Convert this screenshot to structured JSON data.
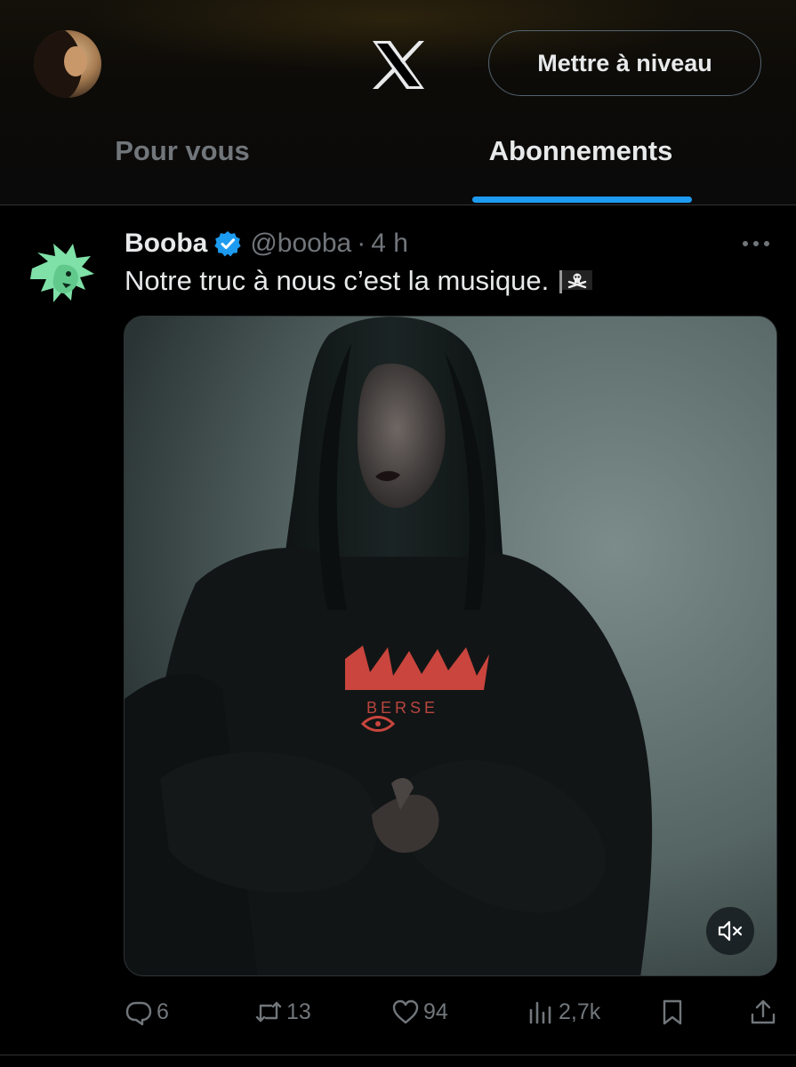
{
  "header": {
    "upgrade_label": "Mettre à niveau",
    "tabs": [
      {
        "label": "Pour vous",
        "active": false
      },
      {
        "label": "Abonnements",
        "active": true
      }
    ],
    "logo_icon": "x-logo-icon",
    "avatar_icon": "profile-avatar"
  },
  "tweet": {
    "author_name": "Booba",
    "verified": true,
    "handle": "@booba",
    "separator": "·",
    "time": "4 h",
    "text": "Notre truc à nous c’est la musique.",
    "emoji": "pirate-flag-icon",
    "media": {
      "type": "video",
      "shirt_text": "BERSE",
      "muted": true
    },
    "actions": {
      "replies": "6",
      "retweets": "13",
      "likes": "94",
      "views": "2,7k"
    }
  },
  "colors": {
    "background": "#000000",
    "accent": "#1d9bf0",
    "text_primary": "#e7e9ea",
    "text_secondary": "#71767b",
    "author_avatar_green": "#7fe0a8"
  }
}
